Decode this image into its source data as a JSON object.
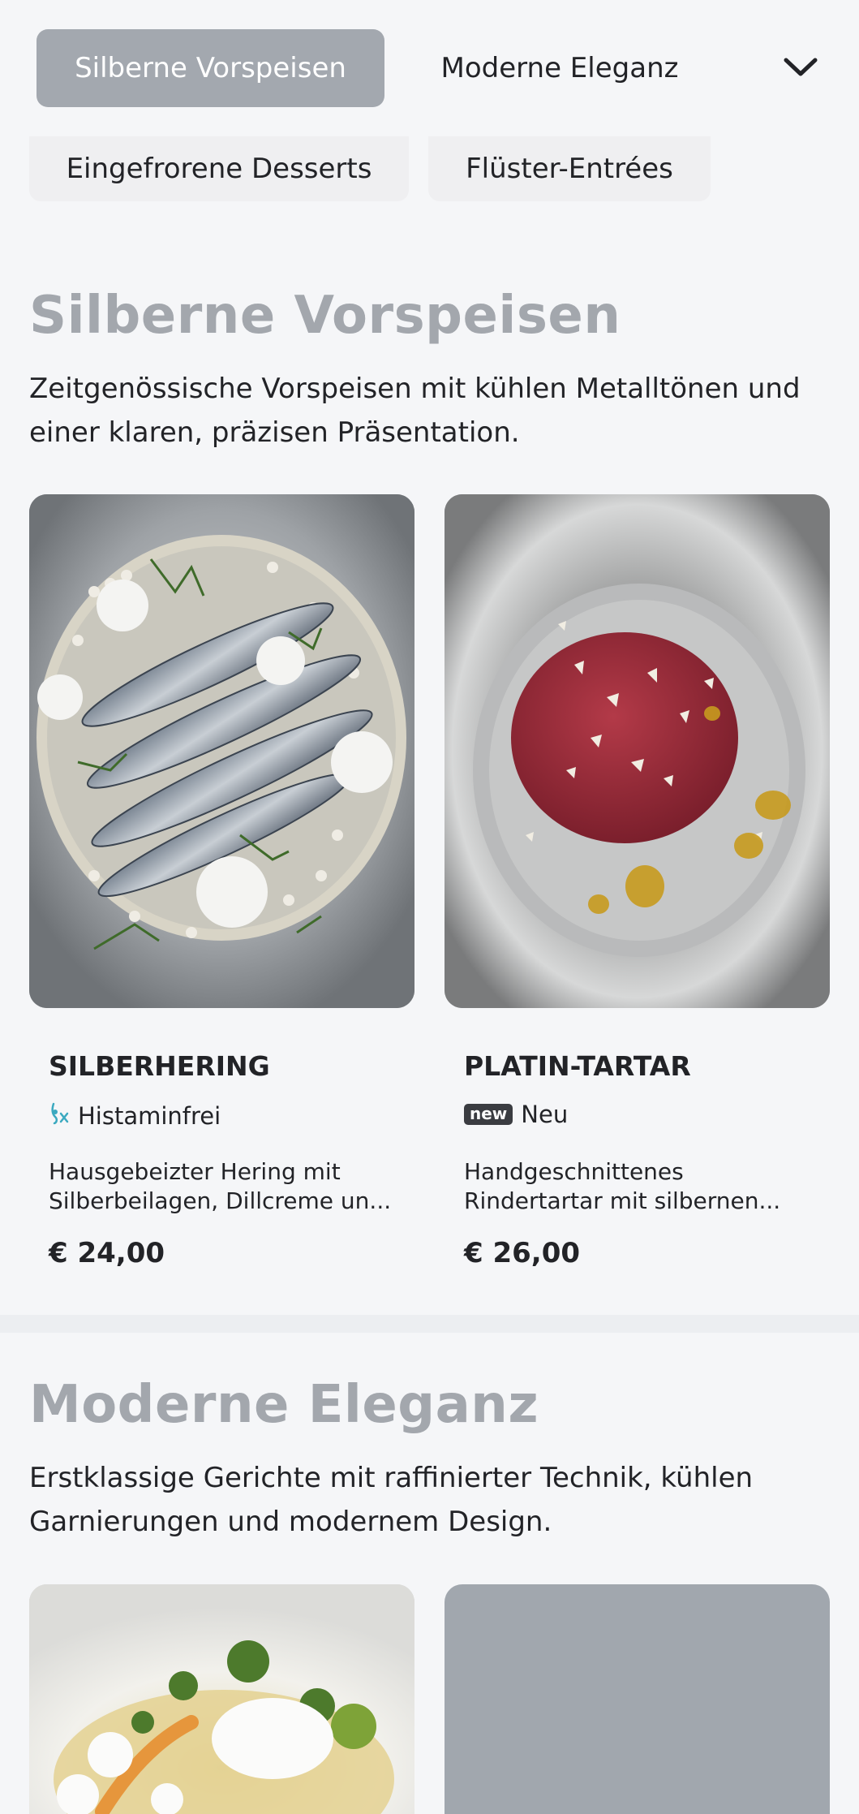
{
  "nav": {
    "active_chip": "Silberne Vorspeisen",
    "second_chip": "Moderne Eleganz",
    "row2": [
      "Eingefrorene Desserts",
      "Flüster-Entrées"
    ],
    "expand_icon": "chevron-down-icon"
  },
  "sections": [
    {
      "title": "Silberne Vorspeisen",
      "description": "Zeitgenössische Vorspeisen mit kühlen Metalltönen und einer klaren, präzisen Präsentation.",
      "items": [
        {
          "name": "SILBERHERING",
          "tag_icon": "histamine-free-icon",
          "tag": "Histaminfrei",
          "description_lines": [
            "Hausgebeizter Hering mit",
            "Silberbeilagen, Dillcreme un..."
          ],
          "price": "€ 24,00"
        },
        {
          "name": "PLATIN-TARTAR",
          "tag_badge": "new",
          "tag": "Neu",
          "description_lines": [
            "Handgeschnittenes",
            "Rindertartar mit silbernen..."
          ],
          "price": "€ 26,00"
        }
      ]
    },
    {
      "title": "Moderne Eleganz",
      "description": "Erstklassige Gerichte mit raffinierter Technik, kühlen Garnierungen und modernem Design."
    }
  ],
  "colors": {
    "accent_chip": "#a3a8af",
    "title_gray": "#a3a7ad",
    "background": "#f5f6f8",
    "text": "#222327"
  }
}
